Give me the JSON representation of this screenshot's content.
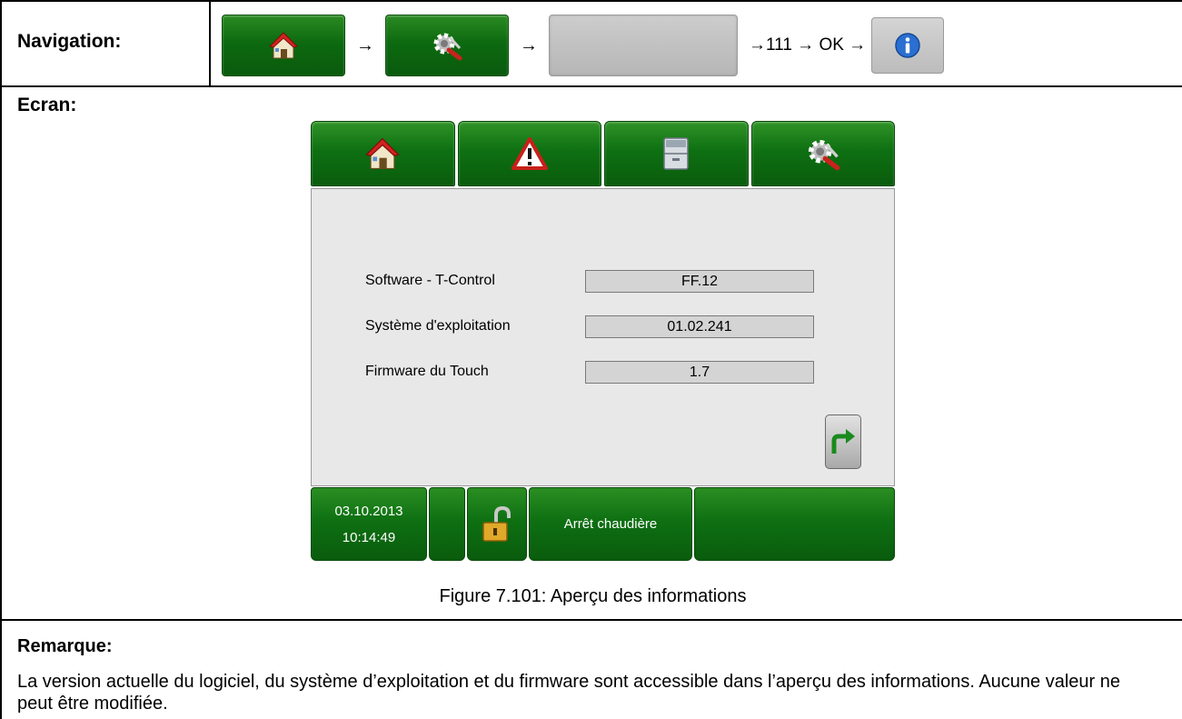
{
  "navigation": {
    "label": "Navigation:",
    "arrow": "→",
    "sequence_text": "→111 → OK →",
    "buttons": [
      "house-icon",
      "settings-tools-icon",
      "blank-grey-button",
      "info-icon"
    ]
  },
  "ecran": {
    "label": "Ecran:",
    "tabs": [
      "house-icon",
      "warning-icon",
      "drawer-icon",
      "settings-tools-icon"
    ],
    "rows": [
      {
        "label": "Software - T-Control",
        "value": "FF.12"
      },
      {
        "label": "Système d'exploitation",
        "value": "01.02.241"
      },
      {
        "label": "Firmware du Touch",
        "value": "1.7"
      }
    ],
    "status_bar": {
      "date": "03.10.2013",
      "time": "10:14:49",
      "status": "Arrêt chaudière"
    },
    "colors": {
      "tab_green": "#0e7012",
      "panel_grey": "#e8e8e8"
    }
  },
  "caption": "Figure 7.101: Aperçu des informations",
  "remarque": {
    "label": "Remarque:",
    "text": "La version actuelle du logiciel, du système d’exploitation et du firmware sont accessible dans l’aperçu des informations. Aucune valeur ne peut être modifiée."
  }
}
